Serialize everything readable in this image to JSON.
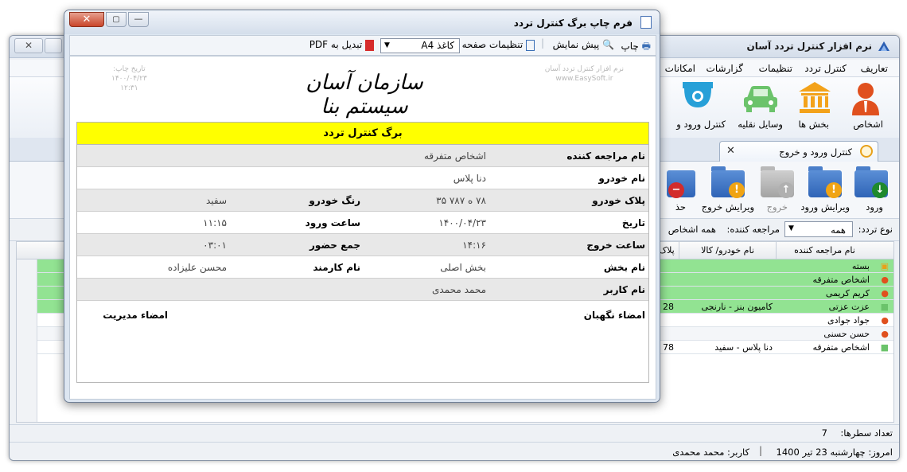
{
  "main": {
    "title": "نرم افزار کنترل تردد آسان",
    "menu": [
      "تعاریف",
      "کنترل تردد",
      "تنظیمات",
      "گزارشات",
      "امکانات"
    ],
    "ribbon": [
      "اشخاص",
      "بخش ها",
      "وسایل نقلیه",
      "کنترل ورود و"
    ],
    "tab_label": "کنترل ورود و خروج",
    "actions": [
      "ورود",
      "ویرایش ورود",
      "خروج",
      "ویرایش خروج",
      "حذ"
    ],
    "filter": {
      "label": "نوع تردد:",
      "value": "همه",
      "visitor_label": "مراجعه کننده:",
      "visitor_value": "همه اشخاص"
    },
    "grid_headers": [
      "نام مراجعه کننده",
      "نام خودرو/ کالا",
      "پلاک"
    ],
    "grid_rows": [
      {
        "name": "بسته",
        "vehicle": "",
        "plate": "",
        "icon": "package",
        "green": true
      },
      {
        "name": "اشخاص متفرقه",
        "vehicle": "",
        "plate": "",
        "icon": "person",
        "green": true
      },
      {
        "name": "کریم کریمی",
        "vehicle": "",
        "plate": "",
        "icon": "person",
        "green": true
      },
      {
        "name": "عزت عزتی",
        "vehicle": "کامیون بنز - نارنجی",
        "plate": "28",
        "icon": "car",
        "green": true
      },
      {
        "name": "جواد جوادی",
        "vehicle": "",
        "plate": "",
        "icon": "person",
        "green": false
      },
      {
        "name": "حسن حسنی",
        "vehicle": "",
        "plate": "",
        "icon": "person",
        "green": false
      },
      {
        "name": "اشخاص متفرقه",
        "vehicle": "دنا پلاس - سفید",
        "plate": "78",
        "icon": "car",
        "green": false
      }
    ],
    "row_count_label": "تعداد سطرها:",
    "row_count": "7",
    "status_date": "امروز: چهارشنبه 23 تیر 1400",
    "status_user": "کاربر: محمد محمدی"
  },
  "dialog": {
    "title": "فرم چاپ برگ کنترل تردد",
    "toolbar": {
      "print": "چاپ",
      "preview": "پیش نمایش",
      "page_settings": "تنظیمات صفحه",
      "paper": "کاغذ A4",
      "pdf": "تبدیل به PDF"
    },
    "report": {
      "watermark_right_1": "نرم افزار کنترل تردد آسان",
      "watermark_right_2": "www.EasySoft.ir",
      "watermark_left_1": "تاریخ چاپ:",
      "watermark_left_2": "۱۴۰۰/۰۴/۲۳",
      "watermark_left_3": "۱۲:۳۱",
      "org_name": "سازمان آسان سیستم بنا",
      "header": "برگ کنترل تردد",
      "visitor_label": "نام مراجعه کننده",
      "visitor_value": "اشخاص متفرقه",
      "car_label": "نام خودرو",
      "car_value": "دنا پلاس",
      "plate_label": "پلاک خودرو",
      "plate_value": "۷۸ ه ۷۸۷ ۳۵",
      "color_label": "رنگ خودرو",
      "color_value": "سفید",
      "date_label": "تاریخ",
      "date_value": "۱۴۰۰/۰۴/۲۳",
      "entry_label": "ساعت ورود",
      "entry_value": "۱۱:۱۵",
      "exit_label": "ساعت خروج",
      "exit_value": "۱۴:۱۶",
      "total_label": "جمع حضور",
      "total_value": "۰۳:۰۱",
      "section_label": "نام بخش",
      "section_value": "بخش اصلی",
      "employee_label": "نام کارمند",
      "employee_value": "محسن علیزاده",
      "user_label": "نام کاربر",
      "user_value": "محمد محمدی",
      "guard_sign": "امضاء نگهبان",
      "manager_sign": "امضاء مدیریت"
    }
  },
  "colors": {
    "row_green": "#92e392",
    "header_yellow": "#ffff00",
    "label_gray": "#e8e8e8"
  }
}
